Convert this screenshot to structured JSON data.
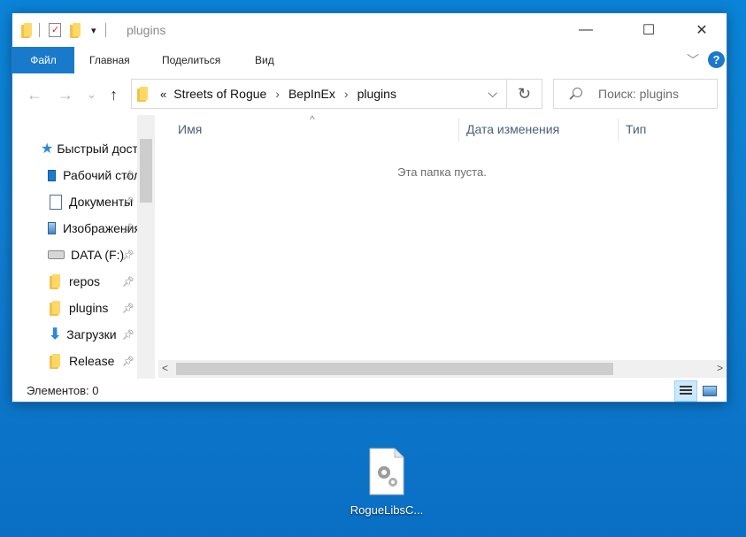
{
  "window": {
    "title": "plugins",
    "controls": {
      "minimize": "—",
      "maximize": "☐",
      "close": "✕"
    }
  },
  "quick_access_toolbar": {
    "dropdown": "▾"
  },
  "ribbon": {
    "tabs": [
      "Файл",
      "Главная",
      "Поделиться",
      "Вид"
    ],
    "expand": "﹀",
    "help": "?"
  },
  "address_bar": {
    "overflow": "«",
    "breadcrumbs": [
      "Streets of Rogue",
      "BepInEx",
      "plugins"
    ],
    "separator": "›",
    "dropdown": "⌵",
    "refresh": "↻"
  },
  "nav_buttons": {
    "back": "←",
    "forward": "→",
    "recent": "⌄",
    "up": "↑"
  },
  "search": {
    "placeholder": "Поиск: plugins"
  },
  "navigation_pane": {
    "header": "Быстрый доступ",
    "items": [
      {
        "label": "Рабочий стол",
        "icon": "desktop-icon"
      },
      {
        "label": "Документы",
        "icon": "documents-icon"
      },
      {
        "label": "Изображения",
        "icon": "pictures-icon"
      },
      {
        "label": "DATA (F:)",
        "icon": "drive-icon"
      },
      {
        "label": "repos",
        "icon": "folder-icon"
      },
      {
        "label": "plugins",
        "icon": "folder-icon"
      },
      {
        "label": "Загрузки",
        "icon": "downloads-icon"
      },
      {
        "label": "Release",
        "icon": "folder-icon"
      }
    ]
  },
  "file_list": {
    "columns": [
      "Имя",
      "Дата изменения",
      "Тип"
    ],
    "sort_indicator": "^",
    "empty_text": "Эта папка пуста."
  },
  "status_bar": {
    "items_count": "Элементов: 0"
  },
  "desktop": {
    "icons": [
      {
        "label": "RogueLibsC..."
      }
    ]
  },
  "colors": {
    "accent": "#1979ca",
    "desktop": "#0a84d8",
    "folder": "#ffd865"
  }
}
